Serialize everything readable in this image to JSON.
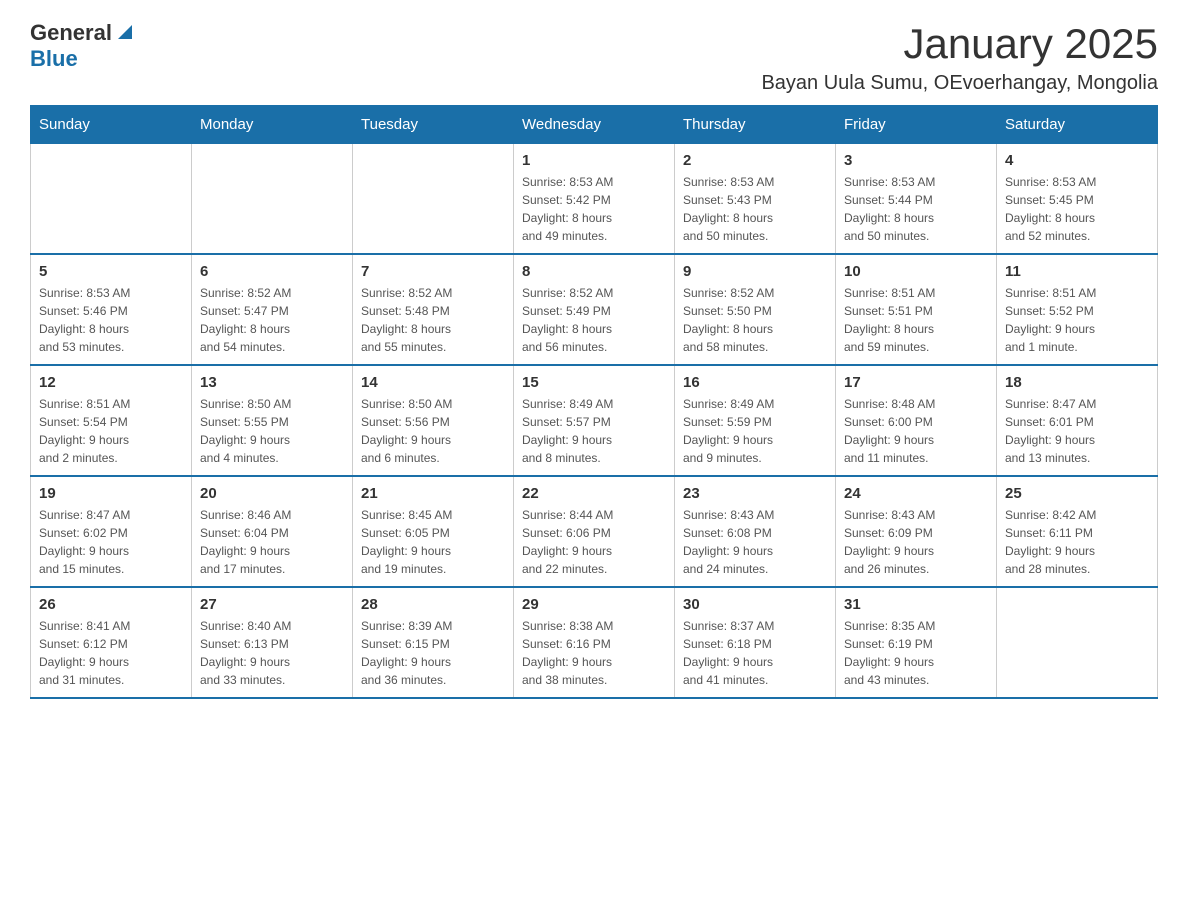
{
  "logo": {
    "general": "General",
    "blue": "Blue"
  },
  "title": "January 2025",
  "subtitle": "Bayan Uula Sumu, OEvoerhangay, Mongolia",
  "weekdays": [
    "Sunday",
    "Monday",
    "Tuesday",
    "Wednesday",
    "Thursday",
    "Friday",
    "Saturday"
  ],
  "weeks": [
    [
      {
        "day": "",
        "info": ""
      },
      {
        "day": "",
        "info": ""
      },
      {
        "day": "",
        "info": ""
      },
      {
        "day": "1",
        "info": "Sunrise: 8:53 AM\nSunset: 5:42 PM\nDaylight: 8 hours\nand 49 minutes."
      },
      {
        "day": "2",
        "info": "Sunrise: 8:53 AM\nSunset: 5:43 PM\nDaylight: 8 hours\nand 50 minutes."
      },
      {
        "day": "3",
        "info": "Sunrise: 8:53 AM\nSunset: 5:44 PM\nDaylight: 8 hours\nand 50 minutes."
      },
      {
        "day": "4",
        "info": "Sunrise: 8:53 AM\nSunset: 5:45 PM\nDaylight: 8 hours\nand 52 minutes."
      }
    ],
    [
      {
        "day": "5",
        "info": "Sunrise: 8:53 AM\nSunset: 5:46 PM\nDaylight: 8 hours\nand 53 minutes."
      },
      {
        "day": "6",
        "info": "Sunrise: 8:52 AM\nSunset: 5:47 PM\nDaylight: 8 hours\nand 54 minutes."
      },
      {
        "day": "7",
        "info": "Sunrise: 8:52 AM\nSunset: 5:48 PM\nDaylight: 8 hours\nand 55 minutes."
      },
      {
        "day": "8",
        "info": "Sunrise: 8:52 AM\nSunset: 5:49 PM\nDaylight: 8 hours\nand 56 minutes."
      },
      {
        "day": "9",
        "info": "Sunrise: 8:52 AM\nSunset: 5:50 PM\nDaylight: 8 hours\nand 58 minutes."
      },
      {
        "day": "10",
        "info": "Sunrise: 8:51 AM\nSunset: 5:51 PM\nDaylight: 8 hours\nand 59 minutes."
      },
      {
        "day": "11",
        "info": "Sunrise: 8:51 AM\nSunset: 5:52 PM\nDaylight: 9 hours\nand 1 minute."
      }
    ],
    [
      {
        "day": "12",
        "info": "Sunrise: 8:51 AM\nSunset: 5:54 PM\nDaylight: 9 hours\nand 2 minutes."
      },
      {
        "day": "13",
        "info": "Sunrise: 8:50 AM\nSunset: 5:55 PM\nDaylight: 9 hours\nand 4 minutes."
      },
      {
        "day": "14",
        "info": "Sunrise: 8:50 AM\nSunset: 5:56 PM\nDaylight: 9 hours\nand 6 minutes."
      },
      {
        "day": "15",
        "info": "Sunrise: 8:49 AM\nSunset: 5:57 PM\nDaylight: 9 hours\nand 8 minutes."
      },
      {
        "day": "16",
        "info": "Sunrise: 8:49 AM\nSunset: 5:59 PM\nDaylight: 9 hours\nand 9 minutes."
      },
      {
        "day": "17",
        "info": "Sunrise: 8:48 AM\nSunset: 6:00 PM\nDaylight: 9 hours\nand 11 minutes."
      },
      {
        "day": "18",
        "info": "Sunrise: 8:47 AM\nSunset: 6:01 PM\nDaylight: 9 hours\nand 13 minutes."
      }
    ],
    [
      {
        "day": "19",
        "info": "Sunrise: 8:47 AM\nSunset: 6:02 PM\nDaylight: 9 hours\nand 15 minutes."
      },
      {
        "day": "20",
        "info": "Sunrise: 8:46 AM\nSunset: 6:04 PM\nDaylight: 9 hours\nand 17 minutes."
      },
      {
        "day": "21",
        "info": "Sunrise: 8:45 AM\nSunset: 6:05 PM\nDaylight: 9 hours\nand 19 minutes."
      },
      {
        "day": "22",
        "info": "Sunrise: 8:44 AM\nSunset: 6:06 PM\nDaylight: 9 hours\nand 22 minutes."
      },
      {
        "day": "23",
        "info": "Sunrise: 8:43 AM\nSunset: 6:08 PM\nDaylight: 9 hours\nand 24 minutes."
      },
      {
        "day": "24",
        "info": "Sunrise: 8:43 AM\nSunset: 6:09 PM\nDaylight: 9 hours\nand 26 minutes."
      },
      {
        "day": "25",
        "info": "Sunrise: 8:42 AM\nSunset: 6:11 PM\nDaylight: 9 hours\nand 28 minutes."
      }
    ],
    [
      {
        "day": "26",
        "info": "Sunrise: 8:41 AM\nSunset: 6:12 PM\nDaylight: 9 hours\nand 31 minutes."
      },
      {
        "day": "27",
        "info": "Sunrise: 8:40 AM\nSunset: 6:13 PM\nDaylight: 9 hours\nand 33 minutes."
      },
      {
        "day": "28",
        "info": "Sunrise: 8:39 AM\nSunset: 6:15 PM\nDaylight: 9 hours\nand 36 minutes."
      },
      {
        "day": "29",
        "info": "Sunrise: 8:38 AM\nSunset: 6:16 PM\nDaylight: 9 hours\nand 38 minutes."
      },
      {
        "day": "30",
        "info": "Sunrise: 8:37 AM\nSunset: 6:18 PM\nDaylight: 9 hours\nand 41 minutes."
      },
      {
        "day": "31",
        "info": "Sunrise: 8:35 AM\nSunset: 6:19 PM\nDaylight: 9 hours\nand 43 minutes."
      },
      {
        "day": "",
        "info": ""
      }
    ]
  ]
}
